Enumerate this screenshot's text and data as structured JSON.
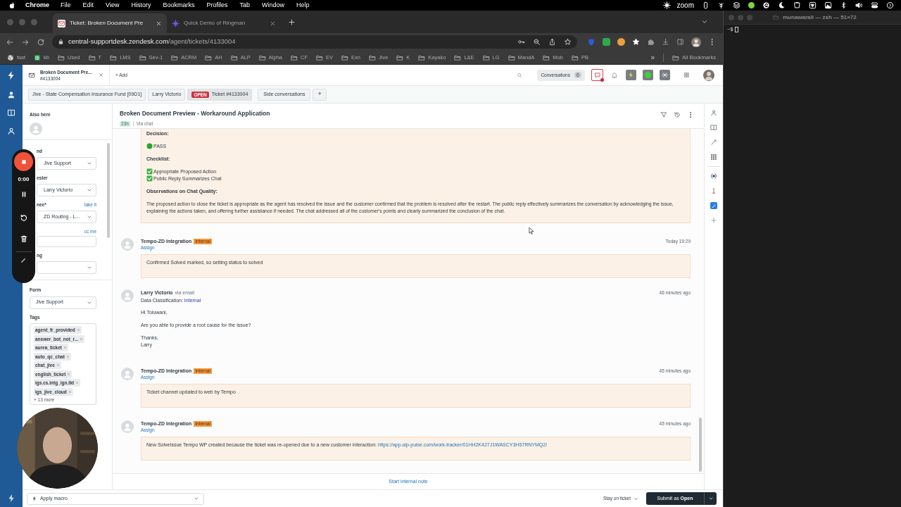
{
  "menubar": {
    "app": "Chrome",
    "items": [
      "File",
      "Edit",
      "View",
      "History",
      "Bookmarks",
      "Profiles",
      "Tab",
      "Window",
      "Help"
    ],
    "zoom_label": "zoom"
  },
  "browser_tabs": [
    {
      "title": "Ticket: Broken Document Pre",
      "selected": true
    },
    {
      "title": "Quick Demo of Ringman",
      "selected": false
    }
  ],
  "address": {
    "host": "central-supportdesk.zendesk.com",
    "path": "/agent/tickets/4133004"
  },
  "bookmarks": [
    {
      "label": "fast",
      "kind": "globe"
    },
    {
      "label": "kb",
      "kind": "sheet"
    },
    {
      "label": "Used",
      "kind": "folder"
    },
    {
      "label": "T",
      "kind": "folder"
    },
    {
      "label": "LMS",
      "kind": "folder"
    },
    {
      "label": "Sev-1",
      "kind": "folder"
    },
    {
      "label": "ACRM",
      "kind": "folder"
    },
    {
      "label": "AH",
      "kind": "folder"
    },
    {
      "label": "ALP",
      "kind": "folder"
    },
    {
      "label": "Alpha",
      "kind": "folder"
    },
    {
      "label": "CF",
      "kind": "folder"
    },
    {
      "label": "EV",
      "kind": "folder"
    },
    {
      "label": "Exn",
      "kind": "folder"
    },
    {
      "label": "Jive",
      "kind": "folder"
    },
    {
      "label": "K",
      "kind": "folder"
    },
    {
      "label": "Kayako",
      "kind": "folder"
    },
    {
      "label": "L&E",
      "kind": "folder"
    },
    {
      "label": "LG",
      "kind": "folder"
    },
    {
      "label": "MandA",
      "kind": "folder"
    },
    {
      "label": "Mob",
      "kind": "folder"
    },
    {
      "label": "PB",
      "kind": "folder"
    }
  ],
  "bookmarks_more": "»",
  "all_bookmarks": "All Bookmarks",
  "terminal": {
    "title": "munawarali — zsh — 51×72",
    "prompt": "~$"
  },
  "topbar": {
    "ticket_tab": {
      "title": "Broken Document Pre...",
      "number": "#4133004"
    },
    "add": "+ Add",
    "conversations": {
      "label": "Conversations",
      "count": "0"
    }
  },
  "breadcrumbs": [
    {
      "label": "Jive - State Compensation Insurance Fund [09D1]",
      "selected": false
    },
    {
      "label": "Larry Victorio",
      "selected": false
    },
    {
      "label": "Ticket #4133004",
      "badge": "OPEN",
      "selected": true
    }
  ],
  "side_conversations": "Side conversations",
  "breadcrumb_add": "+",
  "recorder": {
    "timer": "0:00"
  },
  "sidebar": {
    "also_here": "Also here",
    "fields": [
      {
        "label": "nd",
        "kind": "select",
        "value": "Jive Support"
      },
      {
        "label": "ester",
        "kind": "select",
        "value": "Larry Victorio"
      },
      {
        "label": "nee*",
        "kind": "select",
        "value": "ZD Routing - L...",
        "link": "take it"
      },
      {
        "kind": "input",
        "link": "cc me"
      },
      {
        "label": "ng",
        "kind": "select"
      }
    ],
    "form": {
      "label": "Form",
      "value": "Jive Support"
    },
    "tags": {
      "label": "Tags",
      "items": [
        "agent_fr_provided",
        "answer_bot_not_r...",
        "aurea_ticket",
        "auto_qc_chat",
        "chat_jive",
        "english_ticket",
        "igs.cs.intg_ign.tkt",
        "igs_jive_cloud"
      ],
      "more": "+ 13 more"
    }
  },
  "ticket": {
    "title": "Broken Document Preview - Workaround Application",
    "age": "23h",
    "channel": "Via chat",
    "note_tail": [
      {
        "kind": "heading",
        "text": "Decision:"
      },
      {
        "kind": "status",
        "text": "PASS"
      },
      {
        "kind": "heading",
        "text": "Checklist:"
      },
      {
        "kind": "check",
        "text": "Appropriate Proposed Action"
      },
      {
        "kind": "check",
        "text": "Public Reply Summarizes Chat"
      },
      {
        "kind": "heading",
        "text": "Observations on Chat Quality:"
      },
      {
        "kind": "text",
        "text": "The proposed action to close the ticket is appropriate as the agent has resolved the issue and the customer confirmed that the problem is resolved after the restart. The public reply effectively summarizes the conversation by acknowledging the issue, explaining the actions taken, and offering further assistance if needed. The chat addressed all of the customer's points and clearly summarized the conclusion of the chat."
      }
    ],
    "events": [
      {
        "kind": "internal",
        "author": "Tempo-ZD Integration",
        "badge": "Internal",
        "assign": "Assign",
        "time": "Today 19:29",
        "body": "Confirmed Solved marked, so setting status to solved"
      },
      {
        "kind": "public",
        "author": "Larry Victorio",
        "via": "via email",
        "time": "46 minutes ago",
        "classification": {
          "label": "Data Classification:",
          "value": "Internal"
        },
        "paragraphs": [
          [
            "Hi Toluwani,"
          ],
          [
            "Are you able to provide a root cause for the issue?"
          ],
          [
            "Thanks,",
            "Larry"
          ]
        ]
      },
      {
        "kind": "internal",
        "author": "Tempo-ZD Integration",
        "badge": "Internal",
        "assign": "Assign",
        "time": "45 minutes ago",
        "body": "Ticket channel updated to web by Tempo"
      },
      {
        "kind": "internal",
        "author": "Tempo-ZD Integration",
        "badge": "Internal",
        "assign": "Assign",
        "time": "45 minutes ago",
        "body": "New SolveIssue Tempo WP created because the ticket was re-opened due to a new customer interaction:",
        "link": "https://app.alp-pulse.com/work-tracker/01HH2K427J1WASCY3H57RNYMQ2/"
      }
    ],
    "start_note": "Start internal note"
  },
  "footer": {
    "macro": "Apply macro",
    "stay": "Stay on ticket",
    "submit": "Submit as **Open**"
  }
}
